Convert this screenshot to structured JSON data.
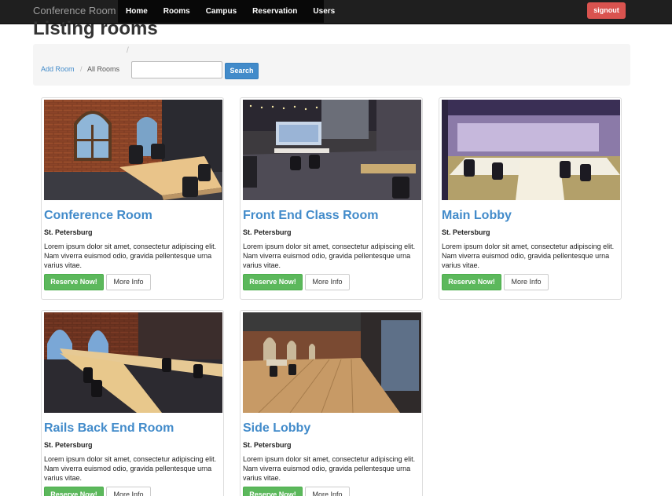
{
  "navbar": {
    "brand": "Conference Room",
    "items": [
      "Home",
      "Rooms",
      "Campus",
      "Reservation",
      "Users"
    ],
    "signout": "signout"
  },
  "page": {
    "title": "Listing rooms"
  },
  "toolbar": {
    "slash": "/",
    "breadcrumb": {
      "link": "Add Room",
      "separator": "/",
      "current": "All Rooms"
    },
    "search": {
      "value": "",
      "placeholder": "",
      "button": "Search"
    }
  },
  "rooms": [
    {
      "name": "Conference Room",
      "city": "St. Petersburg",
      "description": "Lorem ipsum dolor sit amet, consectetur adipiscing elit. Nam viverra euismod odio, gravida pellentesque urna varius vitae.",
      "reserve": "Reserve Now!",
      "more": "More Info"
    },
    {
      "name": "Front End Class Room",
      "city": "St. Petersburg",
      "description": "Lorem ipsum dolor sit amet, consectetur adipiscing elit. Nam viverra euismod odio, gravida pellentesque urna varius vitae.",
      "reserve": "Reserve Now!",
      "more": "More Info"
    },
    {
      "name": "Main Lobby",
      "city": "St. Petersburg",
      "description": "Lorem ipsum dolor sit amet, consectetur adipiscing elit. Nam viverra euismod odio, gravida pellentesque urna varius vitae.",
      "reserve": "Reserve Now!",
      "more": "More Info"
    },
    {
      "name": "Rails Back End Room",
      "city": "St. Petersburg",
      "description": "Lorem ipsum dolor sit amet, consectetur adipiscing elit. Nam viverra euismod odio, gravida pellentesque urna varius vitae.",
      "reserve": "Reserve Now!",
      "more": "More Info"
    },
    {
      "name": "Side Lobby",
      "city": "St. Petersburg",
      "description": "Lorem ipsum dolor sit amet, consectetur adipiscing elit. Nam viverra euismod odio, gravida pellentesque urna varius vitae.",
      "reserve": "Reserve Now!",
      "more": "More Info"
    }
  ],
  "colors": {
    "navbar": "#1f1f1f",
    "link": "#428bca",
    "success": "#5cb85c",
    "danger": "#d9534f"
  }
}
